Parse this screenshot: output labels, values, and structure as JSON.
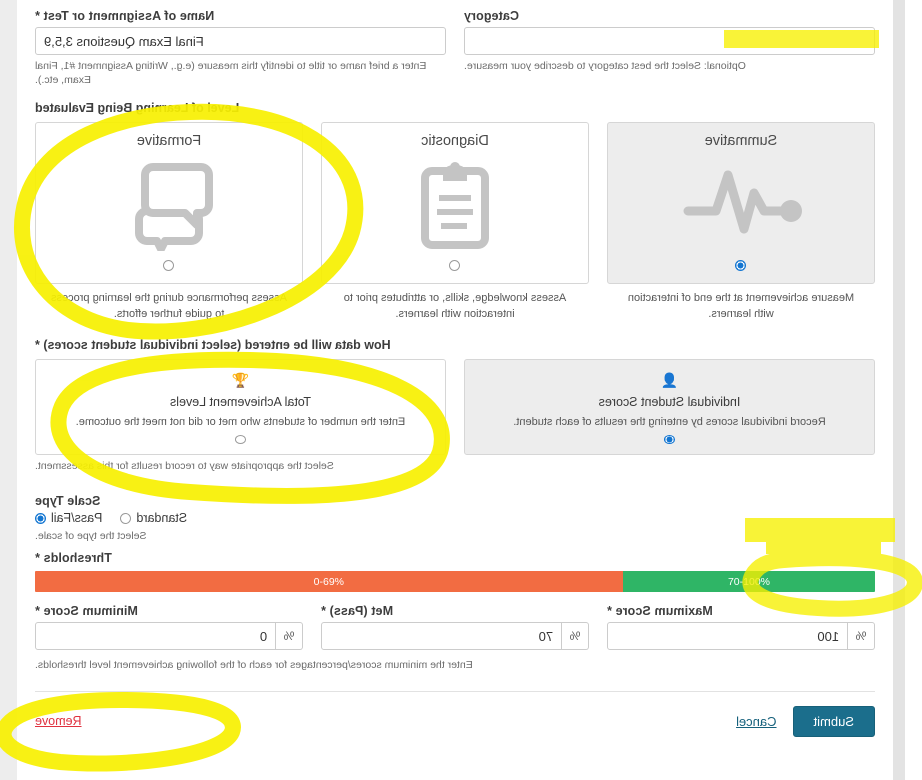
{
  "form": {
    "assignment_name": {
      "label": "Name of Assignment or Test *",
      "value": "Final Exam Questions 3,5,9",
      "placeholder": "",
      "helper": "Enter a brief name or title to identify this measure (e.g., Writing Assignment #1, Final Exam, etc.)."
    },
    "category": {
      "label": "Category",
      "value": "",
      "placeholder": "",
      "helper": "Optional: Select the best category to describe your measure."
    },
    "level_of_learning": {
      "heading": "Level of Learning Being Evaluated",
      "options": [
        {
          "title": "Formative",
          "icon": "speech-bubbles-icon",
          "caption": "Assess performance during the learning process to guide further efforts.",
          "selected": false
        },
        {
          "title": "Diagnostic",
          "icon": "clipboard-icon",
          "caption": "Assess knowledge, skills, or attributes prior to interaction with learners.",
          "selected": false
        },
        {
          "title": "Summative",
          "icon": "pulse-icon",
          "caption": "Measure achievement at the end of interaction with learners.",
          "selected": true
        }
      ]
    },
    "data_entry": {
      "heading": "How data will be entered (select individual student scores) *",
      "helper": "Select the appropriate way to record results for this assessment.",
      "options": [
        {
          "title": "Total Achievement Levels",
          "icon": "trophy-icon",
          "caption": "Enter the number of students who met or did not meet the outcome.",
          "selected": false
        },
        {
          "title": "Individual Student Scores",
          "icon": "person-icon",
          "caption": "Record individual scores by entering the results of each student.",
          "selected": true
        }
      ]
    },
    "scale_type": {
      "label": "Scale Type",
      "helper": "Select the type of scale.",
      "options": [
        {
          "label": "Standard",
          "selected": false
        },
        {
          "label": "Pass/Fail",
          "selected": true
        }
      ]
    },
    "thresholds": {
      "label": "Thresholds *",
      "helper": "Enter the minimum scores/percentages for each of the following achievement level thresholds.",
      "bar": [
        {
          "label": "0-69%",
          "color": "#f26c42",
          "width_pct": 70
        },
        {
          "label": "70-100%",
          "color": "#2fb566",
          "width_pct": 30
        }
      ],
      "fields": [
        {
          "label": "Minimum Score *",
          "value": "0",
          "unit": "%"
        },
        {
          "label": "Met (Pass) *",
          "value": "70",
          "unit": "%"
        },
        {
          "label": "Maximum Score *",
          "value": "100",
          "unit": "%"
        }
      ]
    },
    "footer": {
      "submit_label": "Submit",
      "cancel_label": "Cancel",
      "remove_label": "Remove"
    }
  },
  "annotations": {
    "color": "#f7f000",
    "shapes": [
      "circle-around-summative-card",
      "circle-around-individual-student-scores-card",
      "highlight-assignment-name-value",
      "highlight-scale-type-row",
      "circle-around-submit-cancel"
    ]
  }
}
